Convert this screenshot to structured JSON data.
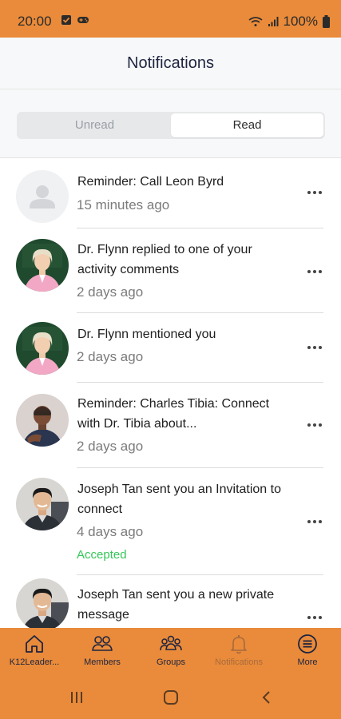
{
  "status_bar": {
    "time": "20:00",
    "battery": "100%"
  },
  "header": {
    "title": "Notifications"
  },
  "tabs": {
    "unread": "Unread",
    "read": "Read",
    "selected": "Read"
  },
  "notifications": [
    {
      "text": "Reminder: Call Leon Byrd",
      "time": "15 minutes ago",
      "avatar": "placeholder-avatar"
    },
    {
      "text": "Dr. Flynn replied to one of your activity comments",
      "time": "2 days ago",
      "avatar": "dr-flynn-avatar"
    },
    {
      "text": "Dr. Flynn mentioned you",
      "time": "2 days ago",
      "avatar": "dr-flynn-avatar"
    },
    {
      "text": "Reminder: Charles Tibia: Connect with Dr. Tibia about...",
      "time": "2 days ago",
      "avatar": "charles-tibia-avatar"
    },
    {
      "text": "Joseph Tan sent you an Invitation to connect",
      "time": "4 days ago",
      "status": "Accepted",
      "avatar": "joseph-tan-avatar"
    },
    {
      "text": "Joseph Tan sent you a new private message",
      "avatar": "joseph-tan-avatar"
    }
  ],
  "bottom_nav": [
    {
      "label": "K12Leader...",
      "icon": "home-icon"
    },
    {
      "label": "Members",
      "icon": "members-icon"
    },
    {
      "label": "Groups",
      "icon": "groups-icon"
    },
    {
      "label": "Notifications",
      "icon": "bell-icon",
      "active": true
    },
    {
      "label": "More",
      "icon": "menu-icon"
    }
  ],
  "colors": {
    "brand": "#e98b3a",
    "accepted": "#34c759",
    "active_nav": "#a86a3c"
  }
}
